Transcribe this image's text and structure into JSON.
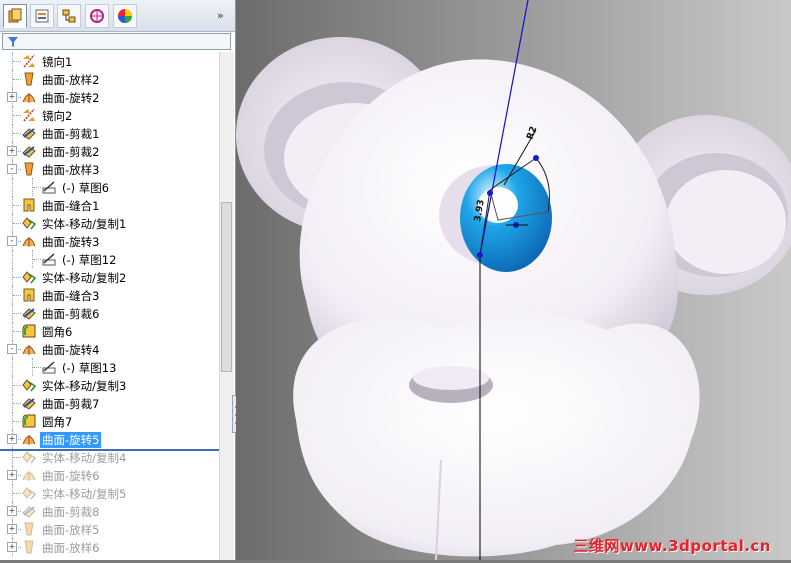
{
  "tabs": [
    {
      "name": "feature-manager-tab",
      "icon": "feature-manager-icon",
      "active": true
    },
    {
      "name": "property-manager-tab",
      "icon": "property-manager-icon",
      "active": false
    },
    {
      "name": "configuration-manager-tab",
      "icon": "configuration-manager-icon",
      "active": false
    },
    {
      "name": "dimxpert-manager-tab",
      "icon": "dimxpert-icon",
      "active": false
    },
    {
      "name": "display-manager-tab",
      "icon": "display-manager-icon",
      "active": false
    }
  ],
  "collapse_label": "»",
  "filter_icon": "filter-icon",
  "tree": [
    {
      "label": "镜向1",
      "icon": "mirror",
      "level": 0,
      "expander": "none",
      "state": "normal"
    },
    {
      "label": "曲面-放样2",
      "icon": "loft",
      "level": 0,
      "expander": "none",
      "state": "normal"
    },
    {
      "label": "曲面-旋转2",
      "icon": "revolve",
      "level": 0,
      "expander": "+",
      "state": "normal"
    },
    {
      "label": "镜向2",
      "icon": "mirror",
      "level": 0,
      "expander": "none",
      "state": "normal"
    },
    {
      "label": "曲面-剪裁1",
      "icon": "trim",
      "level": 0,
      "expander": "none",
      "state": "normal"
    },
    {
      "label": "曲面-剪裁2",
      "icon": "trim",
      "level": 0,
      "expander": "+",
      "state": "normal"
    },
    {
      "label": "曲面-放样3",
      "icon": "loft",
      "level": 0,
      "expander": "-",
      "state": "normal"
    },
    {
      "label": "(-) 草图6",
      "icon": "sketch",
      "level": 1,
      "expander": "none",
      "state": "normal"
    },
    {
      "label": "曲面-缝合1",
      "icon": "knit",
      "level": 0,
      "expander": "none",
      "state": "normal"
    },
    {
      "label": "实体-移动/复制1",
      "icon": "move",
      "level": 0,
      "expander": "none",
      "state": "normal"
    },
    {
      "label": "曲面-旋转3",
      "icon": "revolve",
      "level": 0,
      "expander": "-",
      "state": "normal"
    },
    {
      "label": "(-) 草图12",
      "icon": "sketch",
      "level": 1,
      "expander": "none",
      "state": "normal"
    },
    {
      "label": "实体-移动/复制2",
      "icon": "move",
      "level": 0,
      "expander": "none",
      "state": "normal"
    },
    {
      "label": "曲面-缝合3",
      "icon": "knit",
      "level": 0,
      "expander": "none",
      "state": "normal"
    },
    {
      "label": "曲面-剪裁6",
      "icon": "trim",
      "level": 0,
      "expander": "none",
      "state": "normal"
    },
    {
      "label": "圆角6",
      "icon": "fillet",
      "level": 0,
      "expander": "none",
      "state": "normal"
    },
    {
      "label": "曲面-旋转4",
      "icon": "revolve",
      "level": 0,
      "expander": "-",
      "state": "normal"
    },
    {
      "label": "(-) 草图13",
      "icon": "sketch",
      "level": 1,
      "expander": "none",
      "state": "normal"
    },
    {
      "label": "实体-移动/复制3",
      "icon": "move",
      "level": 0,
      "expander": "none",
      "state": "normal"
    },
    {
      "label": "曲面-剪裁7",
      "icon": "trim",
      "level": 0,
      "expander": "none",
      "state": "normal"
    },
    {
      "label": "圆角7",
      "icon": "fillet",
      "level": 0,
      "expander": "none",
      "state": "normal"
    },
    {
      "label": "曲面-旋转5",
      "icon": "revolve",
      "level": 0,
      "expander": "+",
      "state": "selected"
    },
    {
      "label": "实体-移动/复制4",
      "icon": "move",
      "level": 0,
      "expander": "none",
      "state": "suppressed"
    },
    {
      "label": "曲面-旋转6",
      "icon": "revolve",
      "level": 0,
      "expander": "+",
      "state": "suppressed"
    },
    {
      "label": "实体-移动/复制5",
      "icon": "move",
      "level": 0,
      "expander": "none",
      "state": "suppressed"
    },
    {
      "label": "曲面-剪裁8",
      "icon": "trim",
      "level": 0,
      "expander": "+",
      "state": "suppressed"
    },
    {
      "label": "曲面-放样5",
      "icon": "loft",
      "level": 0,
      "expander": "+",
      "state": "suppressed"
    },
    {
      "label": "曲面-放样6",
      "icon": "loft",
      "level": 0,
      "expander": "+",
      "state": "suppressed"
    }
  ],
  "viewport": {
    "model": "monkey-head-surface-model",
    "eye_color": "#1fa6e8",
    "sketch_dims": [
      "3.93",
      "R2"
    ]
  },
  "watermark": "三维网www.3dportal.cn"
}
